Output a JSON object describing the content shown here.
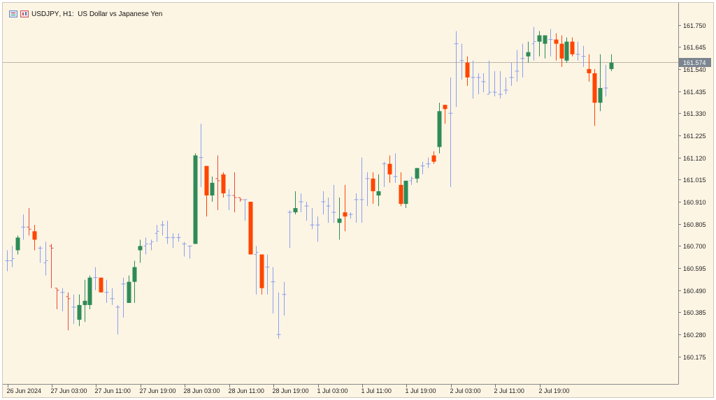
{
  "header": {
    "symbol": "USDJPY",
    "timeframe": "H1",
    "description": "US Dollar vs Japanese Yen"
  },
  "price_scale": {
    "labels": [
      "161.750",
      "161.645",
      "161.540",
      "161.435",
      "161.330",
      "161.225",
      "161.120",
      "161.015",
      "160.910",
      "160.805",
      "160.700",
      "160.595",
      "160.490",
      "160.385",
      "160.280",
      "160.175"
    ],
    "current_price": "161.574"
  },
  "time_scale": {
    "labels": [
      "26 Jun 2024",
      "27 Jun 03:00",
      "27 Jun 11:00",
      "27 Jun 19:00",
      "28 Jun 03:00",
      "28 Jun 11:00",
      "28 Jun 19:00",
      "1 Jul 03:00",
      "1 Jul 11:00",
      "1 Jul 19:00",
      "2 Jul 03:00",
      "2 Jul 11:00",
      "2 Jul 19:00"
    ]
  },
  "colors": {
    "bull": "#2e8b57",
    "bear": "#ff4500",
    "up_bar": "#8a9ff0",
    "down_bar": "#e84a3a",
    "background": "#fdf5e4",
    "bid_line": "#bdb6a8",
    "price_tag": "#7b8590"
  },
  "chart_data": {
    "type": "candlestick",
    "title": "USDJPY, H1: US Dollar vs Japanese Yen",
    "ylim": [
      160.105,
      161.806
    ],
    "grid": false,
    "candles": [
      {
        "o": 160.63,
        "h": 160.68,
        "l": 160.58,
        "c": 160.63
      },
      {
        "o": 160.63,
        "h": 160.7,
        "l": 160.6,
        "c": 160.64
      },
      {
        "o": 160.68,
        "h": 160.75,
        "l": 160.66,
        "c": 160.74
      },
      {
        "o": 160.79,
        "h": 160.85,
        "l": 160.73,
        "c": 160.79
      },
      {
        "o": 160.79,
        "h": 160.88,
        "l": 160.75,
        "c": 160.78
      },
      {
        "o": 160.77,
        "h": 160.8,
        "l": 160.68,
        "c": 160.73
      },
      {
        "o": 160.69,
        "h": 160.7,
        "l": 160.62,
        "c": 160.69
      },
      {
        "o": 160.62,
        "h": 160.72,
        "l": 160.56,
        "c": 160.63
      },
      {
        "o": 160.7,
        "h": 160.71,
        "l": 160.5,
        "c": 160.69
      },
      {
        "o": 160.5,
        "h": 160.5,
        "l": 160.4,
        "c": 160.49
      },
      {
        "o": 160.48,
        "h": 160.5,
        "l": 160.39,
        "c": 160.48
      },
      {
        "o": 160.46,
        "h": 160.48,
        "l": 160.3,
        "c": 160.45
      },
      {
        "o": 160.41,
        "h": 160.47,
        "l": 160.33,
        "c": 160.41
      },
      {
        "o": 160.35,
        "h": 160.47,
        "l": 160.32,
        "c": 160.42
      },
      {
        "o": 160.42,
        "h": 160.54,
        "l": 160.34,
        "c": 160.44
      },
      {
        "o": 160.42,
        "h": 160.56,
        "l": 160.4,
        "c": 160.55
      },
      {
        "o": 160.55,
        "h": 160.6,
        "l": 160.49,
        "c": 160.55
      },
      {
        "o": 160.55,
        "h": 160.55,
        "l": 160.48,
        "c": 160.48
      },
      {
        "o": 160.48,
        "h": 160.54,
        "l": 160.43,
        "c": 160.48
      },
      {
        "o": 160.45,
        "h": 160.5,
        "l": 160.42,
        "c": 160.45
      },
      {
        "o": 160.41,
        "h": 160.42,
        "l": 160.28,
        "c": 160.41
      },
      {
        "o": 160.52,
        "h": 160.55,
        "l": 160.36,
        "c": 160.52
      },
      {
        "o": 160.43,
        "h": 160.56,
        "l": 160.43,
        "c": 160.53
      },
      {
        "o": 160.53,
        "h": 160.63,
        "l": 160.43,
        "c": 160.6
      },
      {
        "o": 160.68,
        "h": 160.73,
        "l": 160.62,
        "c": 160.7
      },
      {
        "o": 160.7,
        "h": 160.74,
        "l": 160.66,
        "c": 160.71
      },
      {
        "o": 160.71,
        "h": 160.73,
        "l": 160.68,
        "c": 160.72
      },
      {
        "o": 160.76,
        "h": 160.8,
        "l": 160.72,
        "c": 160.77
      },
      {
        "o": 160.8,
        "h": 160.82,
        "l": 160.75,
        "c": 160.8
      },
      {
        "o": 160.74,
        "h": 160.82,
        "l": 160.71,
        "c": 160.74
      },
      {
        "o": 160.74,
        "h": 160.76,
        "l": 160.69,
        "c": 160.74
      },
      {
        "o": 160.74,
        "h": 160.76,
        "l": 160.72,
        "c": 160.74
      },
      {
        "o": 160.71,
        "h": 160.72,
        "l": 160.65,
        "c": 160.71
      },
      {
        "o": 160.7,
        "h": 160.7,
        "l": 160.64,
        "c": 160.7
      },
      {
        "o": 160.71,
        "h": 161.14,
        "l": 160.71,
        "c": 161.13
      },
      {
        "o": 161.12,
        "h": 161.28,
        "l": 160.98,
        "c": 161.12
      },
      {
        "o": 161.08,
        "h": 161.08,
        "l": 160.84,
        "c": 160.94
      },
      {
        "o": 160.94,
        "h": 161.03,
        "l": 160.91,
        "c": 161.0
      },
      {
        "o": 161.02,
        "h": 161.13,
        "l": 160.87,
        "c": 161.01
      },
      {
        "o": 161.04,
        "h": 161.05,
        "l": 160.93,
        "c": 160.95
      },
      {
        "o": 160.94,
        "h": 160.97,
        "l": 160.87,
        "c": 160.94
      },
      {
        "o": 160.94,
        "h": 161.05,
        "l": 160.86,
        "c": 160.93
      },
      {
        "o": 160.93,
        "h": 160.93,
        "l": 160.91,
        "c": 160.92
      },
      {
        "o": 160.92,
        "h": 160.92,
        "l": 160.82,
        "c": 160.92
      },
      {
        "o": 160.91,
        "h": 160.91,
        "l": 160.72,
        "c": 160.66
      },
      {
        "o": 160.66,
        "h": 160.7,
        "l": 160.47,
        "c": 160.67
      },
      {
        "o": 160.66,
        "h": 160.66,
        "l": 160.47,
        "c": 160.5
      },
      {
        "o": 160.6,
        "h": 160.66,
        "l": 160.47,
        "c": 160.6
      },
      {
        "o": 160.53,
        "h": 160.6,
        "l": 160.38,
        "c": 160.53
      },
      {
        "o": 160.28,
        "h": 160.48,
        "l": 160.26,
        "c": 160.28
      },
      {
        "o": 160.47,
        "h": 160.53,
        "l": 160.37,
        "c": 160.47
      },
      {
        "o": 160.86,
        "h": 160.87,
        "l": 160.69,
        "c": 160.86
      },
      {
        "o": 160.86,
        "h": 160.96,
        "l": 160.85,
        "c": 160.88
      },
      {
        "o": 160.91,
        "h": 160.95,
        "l": 160.86,
        "c": 160.91
      },
      {
        "o": 160.89,
        "h": 160.91,
        "l": 160.82,
        "c": 160.89
      },
      {
        "o": 160.8,
        "h": 160.88,
        "l": 160.78,
        "c": 160.8
      },
      {
        "o": 160.8,
        "h": 160.84,
        "l": 160.72,
        "c": 160.8
      },
      {
        "o": 160.91,
        "h": 160.96,
        "l": 160.85,
        "c": 160.91
      },
      {
        "o": 160.89,
        "h": 160.93,
        "l": 160.81,
        "c": 160.89
      },
      {
        "o": 160.86,
        "h": 160.99,
        "l": 160.81,
        "c": 160.86
      },
      {
        "o": 160.81,
        "h": 160.93,
        "l": 160.73,
        "c": 160.83
      },
      {
        "o": 160.86,
        "h": 160.99,
        "l": 160.77,
        "c": 160.84
      },
      {
        "o": 160.85,
        "h": 160.86,
        "l": 160.83,
        "c": 160.85
      },
      {
        "o": 160.92,
        "h": 160.95,
        "l": 160.81,
        "c": 160.92
      },
      {
        "o": 160.92,
        "h": 161.12,
        "l": 160.81,
        "c": 160.92
      },
      {
        "o": 161.02,
        "h": 161.05,
        "l": 160.89,
        "c": 161.02
      },
      {
        "o": 161.02,
        "h": 161.05,
        "l": 160.9,
        "c": 160.96
      },
      {
        "o": 160.94,
        "h": 161.04,
        "l": 160.89,
        "c": 160.96
      },
      {
        "o": 161.09,
        "h": 161.1,
        "l": 160.98,
        "c": 161.09
      },
      {
        "o": 161.09,
        "h": 161.13,
        "l": 161.0,
        "c": 161.04
      },
      {
        "o": 161.03,
        "h": 161.14,
        "l": 161.0,
        "c": 161.03
      },
      {
        "o": 160.99,
        "h": 161.05,
        "l": 160.89,
        "c": 160.9
      },
      {
        "o": 160.9,
        "h": 161.01,
        "l": 160.88,
        "c": 161.01
      },
      {
        "o": 161.01,
        "h": 161.03,
        "l": 160.99,
        "c": 161.02
      },
      {
        "o": 161.02,
        "h": 161.07,
        "l": 161.0,
        "c": 161.07
      },
      {
        "o": 161.08,
        "h": 161.1,
        "l": 161.04,
        "c": 161.08
      },
      {
        "o": 161.09,
        "h": 161.12,
        "l": 161.07,
        "c": 161.09
      },
      {
        "o": 161.13,
        "h": 161.15,
        "l": 161.09,
        "c": 161.1
      },
      {
        "o": 161.17,
        "h": 161.38,
        "l": 161.14,
        "c": 161.34
      },
      {
        "o": 161.37,
        "h": 161.37,
        "l": 161.28,
        "c": 161.35
      },
      {
        "o": 161.33,
        "h": 161.5,
        "l": 160.98,
        "c": 161.33
      },
      {
        "o": 161.66,
        "h": 161.72,
        "l": 161.36,
        "c": 161.66
      },
      {
        "o": 161.58,
        "h": 161.66,
        "l": 161.49,
        "c": 161.58
      },
      {
        "o": 161.57,
        "h": 161.6,
        "l": 161.46,
        "c": 161.5
      },
      {
        "o": 161.5,
        "h": 161.58,
        "l": 161.4,
        "c": 161.5
      },
      {
        "o": 161.5,
        "h": 161.52,
        "l": 161.42,
        "c": 161.5
      },
      {
        "o": 161.48,
        "h": 161.52,
        "l": 161.43,
        "c": 161.48
      },
      {
        "o": 161.42,
        "h": 161.58,
        "l": 161.42,
        "c": 161.43
      },
      {
        "o": 161.43,
        "h": 161.53,
        "l": 161.41,
        "c": 161.43
      },
      {
        "o": 161.42,
        "h": 161.53,
        "l": 161.4,
        "c": 161.42
      },
      {
        "o": 161.44,
        "h": 161.5,
        "l": 161.42,
        "c": 161.44
      },
      {
        "o": 161.5,
        "h": 161.57,
        "l": 161.46,
        "c": 161.5
      },
      {
        "o": 161.53,
        "h": 161.63,
        "l": 161.48,
        "c": 161.53
      },
      {
        "o": 161.59,
        "h": 161.66,
        "l": 161.5,
        "c": 161.59
      },
      {
        "o": 161.6,
        "h": 161.67,
        "l": 161.57,
        "c": 161.62
      },
      {
        "o": 161.66,
        "h": 161.74,
        "l": 161.58,
        "c": 161.67
      },
      {
        "o": 161.67,
        "h": 161.72,
        "l": 161.6,
        "c": 161.7
      },
      {
        "o": 161.66,
        "h": 161.7,
        "l": 161.59,
        "c": 161.7
      },
      {
        "o": 161.68,
        "h": 161.73,
        "l": 161.6,
        "c": 161.68
      },
      {
        "o": 161.68,
        "h": 161.71,
        "l": 161.58,
        "c": 161.66
      },
      {
        "o": 161.66,
        "h": 161.7,
        "l": 161.55,
        "c": 161.59
      },
      {
        "o": 161.58,
        "h": 161.69,
        "l": 161.57,
        "c": 161.67
      },
      {
        "o": 161.67,
        "h": 161.69,
        "l": 161.6,
        "c": 161.61
      },
      {
        "o": 161.61,
        "h": 161.67,
        "l": 161.58,
        "c": 161.61
      },
      {
        "o": 161.6,
        "h": 161.65,
        "l": 161.55,
        "c": 161.6
      },
      {
        "o": 161.54,
        "h": 161.61,
        "l": 161.48,
        "c": 161.52
      },
      {
        "o": 161.52,
        "h": 161.54,
        "l": 161.27,
        "c": 161.38
      },
      {
        "o": 161.38,
        "h": 161.61,
        "l": 161.34,
        "c": 161.45
      },
      {
        "o": 161.45,
        "h": 161.56,
        "l": 161.41,
        "c": 161.45
      },
      {
        "o": 161.54,
        "h": 161.61,
        "l": 161.53,
        "c": 161.57
      }
    ]
  }
}
